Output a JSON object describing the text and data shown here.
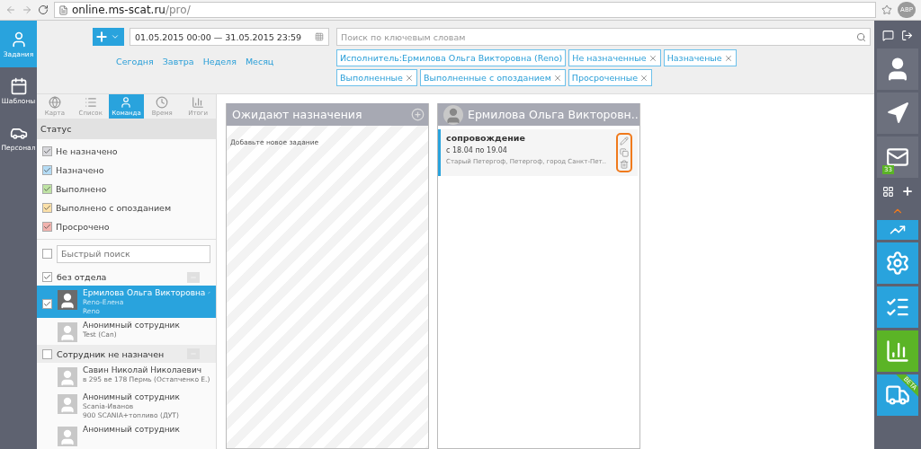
{
  "browser": {
    "url_host": "online.ms-scat.ru",
    "url_path": "/pro/",
    "profile": "АВР"
  },
  "left_nav": [
    {
      "label": "Задания",
      "selected": true
    },
    {
      "label": "Шаблоны",
      "selected": false
    },
    {
      "label": "Персонал",
      "selected": false
    }
  ],
  "toolbar": {
    "date_range": "01.05.2015 00:00 — 31.05.2015 23:59",
    "quick_links": [
      "Сегодня",
      "Завтра",
      "Неделя",
      "Месяц"
    ],
    "search": {
      "placeholder": "Поиск по ключевым словам"
    },
    "filters": [
      {
        "label": "Исполнитель:Ермилова Ольга Викторовна (Reno)",
        "removable": false
      },
      {
        "label": "Не назначенные",
        "removable": true
      },
      {
        "label": "Назначеные",
        "removable": true
      },
      {
        "label": "Выполненные",
        "removable": true
      },
      {
        "label": "Выполненные с опозданием",
        "removable": true
      },
      {
        "label": "Просроченные",
        "removable": true
      }
    ]
  },
  "sidebar": {
    "tabs": [
      {
        "label": "Карта",
        "selected": false
      },
      {
        "label": "Список",
        "selected": false
      },
      {
        "label": "Команда",
        "selected": true
      },
      {
        "label": "Время",
        "selected": false
      },
      {
        "label": "Итоги",
        "selected": false
      }
    ],
    "status_title": "Статус",
    "statuses": [
      {
        "label": "Не назначено",
        "checked": true,
        "color": "#d8d8dc"
      },
      {
        "label": "Назначено",
        "checked": true,
        "color": "#b5dcf5"
      },
      {
        "label": "Выполнено",
        "checked": true,
        "color": "#bfe3a4"
      },
      {
        "label": "Выполнено с опозданием",
        "checked": true,
        "color": "#fbe0a8"
      },
      {
        "label": "Просрочено",
        "checked": true,
        "color": "#f2b3ae"
      }
    ],
    "quick_search": {
      "placeholder": "Быстрый поиск",
      "checked": false
    },
    "groups": [
      {
        "name": "без отдела",
        "checked": true,
        "employees": [
          {
            "name": "Ермилова Ольга Викторовна",
            "lines": [
              "Reno-Елена",
              "Reno"
            ],
            "selected": true,
            "checked": true
          },
          {
            "name": "Анонимный сотрудник",
            "lines": [
              "Test (Can)"
            ],
            "selected": false,
            "checked": false
          }
        ]
      },
      {
        "name": "Сотрудник не назначен",
        "checked": false,
        "employees": [
          {
            "name": "Савин Николай Николаевич",
            "lines": [
              "в 295 ве 178 Пермь (Остапченко Е.)"
            ],
            "selected": false,
            "checked": false
          },
          {
            "name": "Анонимный сотрудник",
            "lines": [
              "Scania-Иванов",
              "900 SCANIA+топливо (ДУТ)"
            ],
            "selected": false,
            "checked": false
          },
          {
            "name": "Анонимный сотрудник",
            "selected": false,
            "checked": false
          }
        ]
      }
    ]
  },
  "board": [
    {
      "kind": "unassigned",
      "title": "Ожидают назначения",
      "hint": "Добавьте новое задание"
    },
    {
      "kind": "employee",
      "title": "Ермилова Ольга Викторовн..",
      "tasks": [
        {
          "title": "сопровождение",
          "dates": "с 18.04 по 19.04",
          "address": "Старый Петергоф, Петергоф, город Санкт-Пет.."
        }
      ]
    }
  ],
  "right_rail": {
    "messages_badge": "33",
    "beta_label": "BETA"
  }
}
